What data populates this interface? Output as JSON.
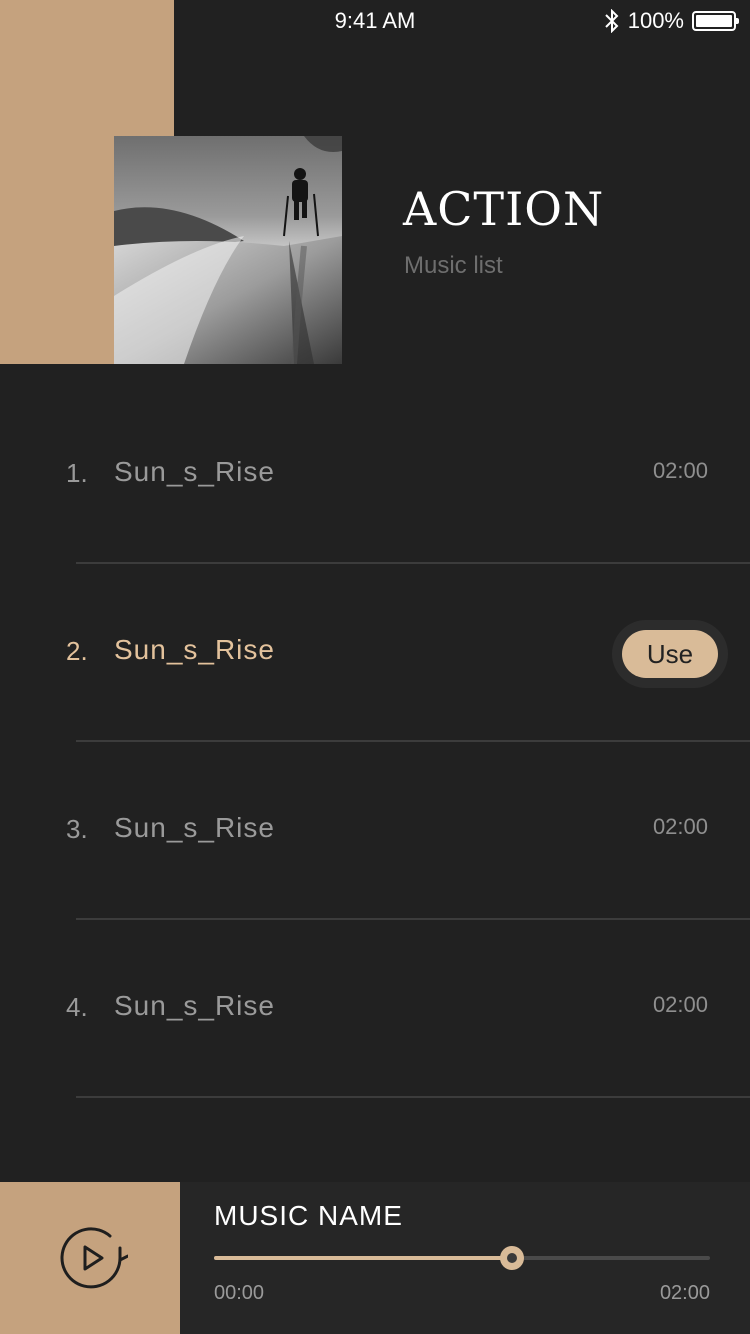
{
  "status": {
    "time": "9:41 AM",
    "battery": "100%"
  },
  "album": {
    "title": "ACTION",
    "subtitle": "Music list"
  },
  "tracks": [
    {
      "num": "1.",
      "name": "Sun_s_Rise",
      "duration": "02:00",
      "active": false
    },
    {
      "num": "2.",
      "name": "Sun_s_Rise",
      "action": "Use",
      "active": true
    },
    {
      "num": "3.",
      "name": "Sun_s_Rise",
      "duration": "02:00",
      "active": false
    },
    {
      "num": "4.",
      "name": "Sun_s_Rise",
      "duration": "02:00",
      "active": false
    }
  ],
  "player": {
    "name": "MUSIC NAME",
    "current": "00:00",
    "total": "02:00",
    "progress": 0.6,
    "icon": "replay-play-icon"
  },
  "colors": {
    "accent": "#c5a27e",
    "background": "#212121",
    "highlight": "#e3c29c"
  }
}
